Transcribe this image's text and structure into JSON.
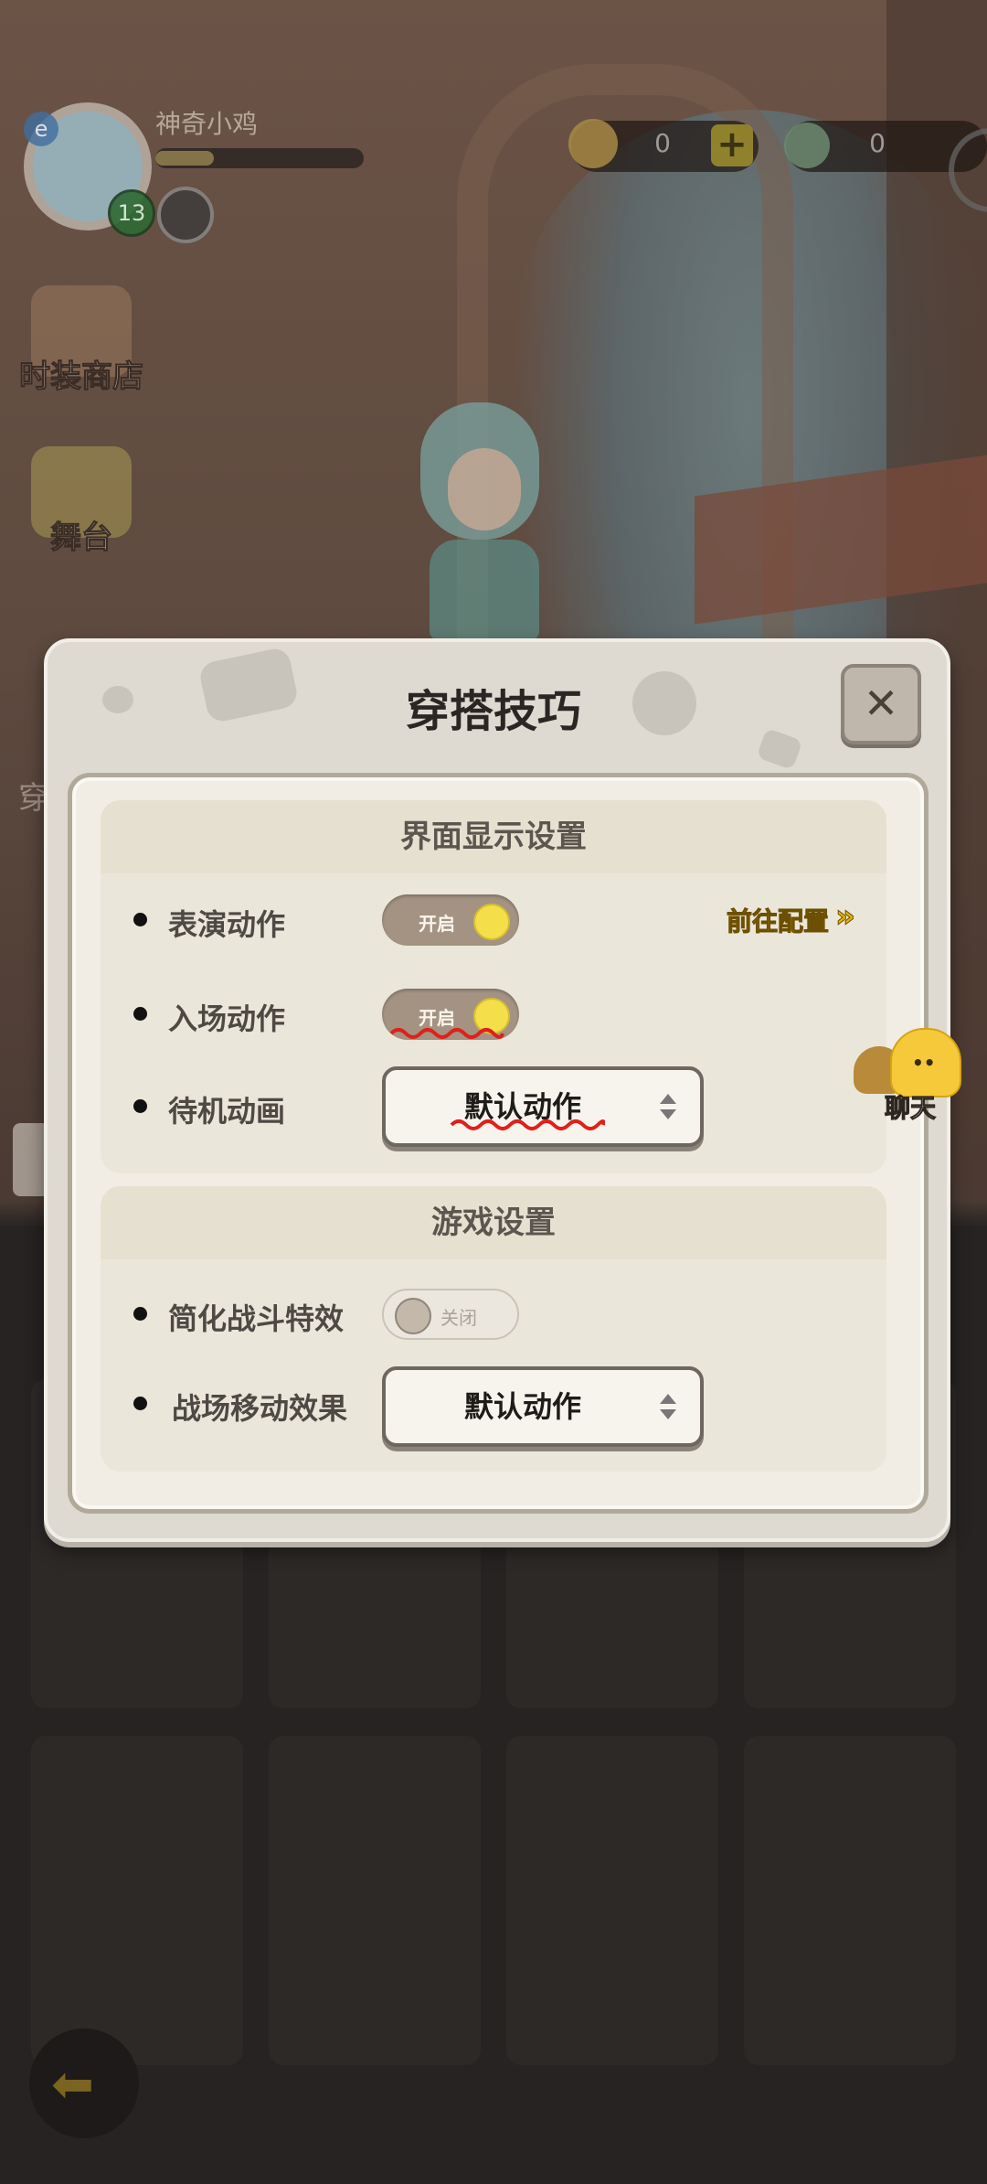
{
  "player": {
    "name": "神奇小鸡",
    "level": "13",
    "xp_fraction": 0.28,
    "avatar_badge": "e"
  },
  "currency": {
    "gold": "0",
    "gems": "0"
  },
  "side_menu": {
    "shop": "时装商店",
    "stage": "舞台",
    "partial_char": "穿"
  },
  "dialog": {
    "title": "穿搭技巧",
    "close_symbol": "✕",
    "display_section": {
      "header": "界面显示设置",
      "goto_label": "前往配置",
      "goto_arrow": "»",
      "rows": [
        {
          "label": "表演动作",
          "toggle": "开启",
          "state": "on"
        },
        {
          "label": "入场动作",
          "toggle": "开启",
          "state": "on"
        },
        {
          "label": "待机动画",
          "select": "默认动作"
        }
      ]
    },
    "game_section": {
      "header": "游戏设置",
      "rows": [
        {
          "label": "简化战斗特效",
          "toggle": "关闭",
          "state": "off"
        },
        {
          "label": "战场移动效果",
          "select": "默认动作"
        }
      ]
    }
  },
  "chat": {
    "label": "聊天",
    "face": "••"
  },
  "colors": {
    "accent_yellow": "#e7b400",
    "toggle_on_knob": "#f4de4a",
    "dialog_bg": "#dedad2",
    "squiggle_red": "#e0201a"
  }
}
